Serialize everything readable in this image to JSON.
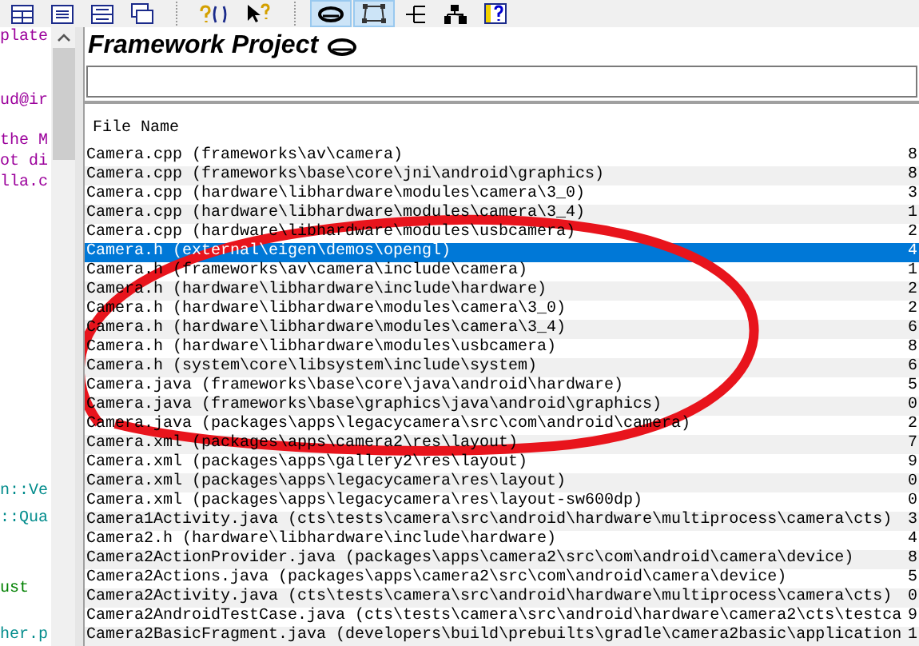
{
  "toolbar": {
    "buttons": [
      {
        "kind": "grid",
        "selected": false
      },
      {
        "kind": "list",
        "selected": false
      },
      {
        "kind": "split",
        "selected": false
      },
      {
        "kind": "windows",
        "selected": false
      },
      {
        "kind": "help-context",
        "selected": false
      },
      {
        "kind": "pointer-help",
        "selected": false
      },
      {
        "kind": "ring",
        "selected": true
      },
      {
        "kind": "frame",
        "selected": true
      },
      {
        "kind": "tree",
        "selected": false
      },
      {
        "kind": "hierarchy",
        "selected": false
      },
      {
        "kind": "help-book",
        "selected": false
      }
    ]
  },
  "editor": {
    "lines": [
      {
        "text": "plate",
        "color": "#9b009b"
      },
      {
        "text": "ud@ir",
        "color": "#9b009b"
      },
      {
        "text": "the M",
        "color": "#9b009b"
      },
      {
        "text": "ot di",
        "color": "#9b009b"
      },
      {
        "text": "lla.c",
        "color": "#9b009b"
      },
      {
        "text": "n::Ve",
        "color": "#008b8b"
      },
      {
        "text": "::Qua",
        "color": "#008b8b"
      },
      {
        "text": "ust",
        "color": "#008000"
      },
      {
        "text": "her.p",
        "color": "#008b8b"
      }
    ]
  },
  "panel": {
    "title": "Framework Project",
    "table": {
      "columns": [
        "File Name"
      ],
      "rows": [
        {
          "name": "Camera.cpp (frameworks\\av\\camera)",
          "column_2": "8",
          "selected": false
        },
        {
          "name": "Camera.cpp (frameworks\\base\\core\\jni\\android\\graphics)",
          "column_2": "8",
          "selected": false
        },
        {
          "name": "Camera.cpp (hardware\\libhardware\\modules\\camera\\3_0)",
          "column_2": "3",
          "selected": false
        },
        {
          "name": "Camera.cpp (hardware\\libhardware\\modules\\camera\\3_4)",
          "column_2": "1",
          "selected": false
        },
        {
          "name": "Camera.cpp (hardware\\libhardware\\modules\\usbcamera)",
          "column_2": "2",
          "selected": false
        },
        {
          "name": "Camera.h (external\\eigen\\demos\\opengl)",
          "column_2": "4",
          "selected": true
        },
        {
          "name": "Camera.h (frameworks\\av\\camera\\include\\camera)",
          "column_2": "1",
          "selected": false
        },
        {
          "name": "Camera.h (hardware\\libhardware\\include\\hardware)",
          "column_2": "2",
          "selected": false
        },
        {
          "name": "Camera.h (hardware\\libhardware\\modules\\camera\\3_0)",
          "column_2": "2",
          "selected": false
        },
        {
          "name": "Camera.h (hardware\\libhardware\\modules\\camera\\3_4)",
          "column_2": "6",
          "selected": false
        },
        {
          "name": "Camera.h (hardware\\libhardware\\modules\\usbcamera)",
          "column_2": "8",
          "selected": false
        },
        {
          "name": "Camera.h (system\\core\\libsystem\\include\\system)",
          "column_2": "6",
          "selected": false
        },
        {
          "name": "Camera.java (frameworks\\base\\core\\java\\android\\hardware)",
          "column_2": "5",
          "selected": false
        },
        {
          "name": "Camera.java (frameworks\\base\\graphics\\java\\android\\graphics)",
          "column_2": "0",
          "selected": false
        },
        {
          "name": "Camera.java (packages\\apps\\legacycamera\\src\\com\\android\\camera)",
          "column_2": "2",
          "selected": false
        },
        {
          "name": "Camera.xml (packages\\apps\\camera2\\res\\layout)",
          "column_2": "7",
          "selected": false
        },
        {
          "name": "Camera.xml (packages\\apps\\gallery2\\res\\layout)",
          "column_2": "9",
          "selected": false
        },
        {
          "name": "Camera.xml (packages\\apps\\legacycamera\\res\\layout)",
          "column_2": "0",
          "selected": false
        },
        {
          "name": "Camera.xml (packages\\apps\\legacycamera\\res\\layout-sw600dp)",
          "column_2": "0",
          "selected": false
        },
        {
          "name": "Camera1Activity.java (cts\\tests\\camera\\src\\android\\hardware\\multiprocess\\camera\\cts)",
          "column_2": "3",
          "selected": false
        },
        {
          "name": "Camera2.h (hardware\\libhardware\\include\\hardware)",
          "column_2": "4",
          "selected": false
        },
        {
          "name": "Camera2ActionProvider.java (packages\\apps\\camera2\\src\\com\\android\\camera\\device)",
          "column_2": "8",
          "selected": false
        },
        {
          "name": "Camera2Actions.java (packages\\apps\\camera2\\src\\com\\android\\camera\\device)",
          "column_2": "5",
          "selected": false
        },
        {
          "name": "Camera2Activity.java (cts\\tests\\camera\\src\\android\\hardware\\multiprocess\\camera\\cts)",
          "column_2": "0",
          "selected": false
        },
        {
          "name": "Camera2AndroidTestCase.java (cts\\tests\\camera\\src\\android\\hardware\\camera2\\cts\\testca",
          "column_2": "9",
          "selected": false
        },
        {
          "name": "Camera2BasicFragment.java (developers\\build\\prebuilts\\gradle\\camera2basic\\application",
          "column_2": "1",
          "selected": false
        }
      ]
    }
  }
}
